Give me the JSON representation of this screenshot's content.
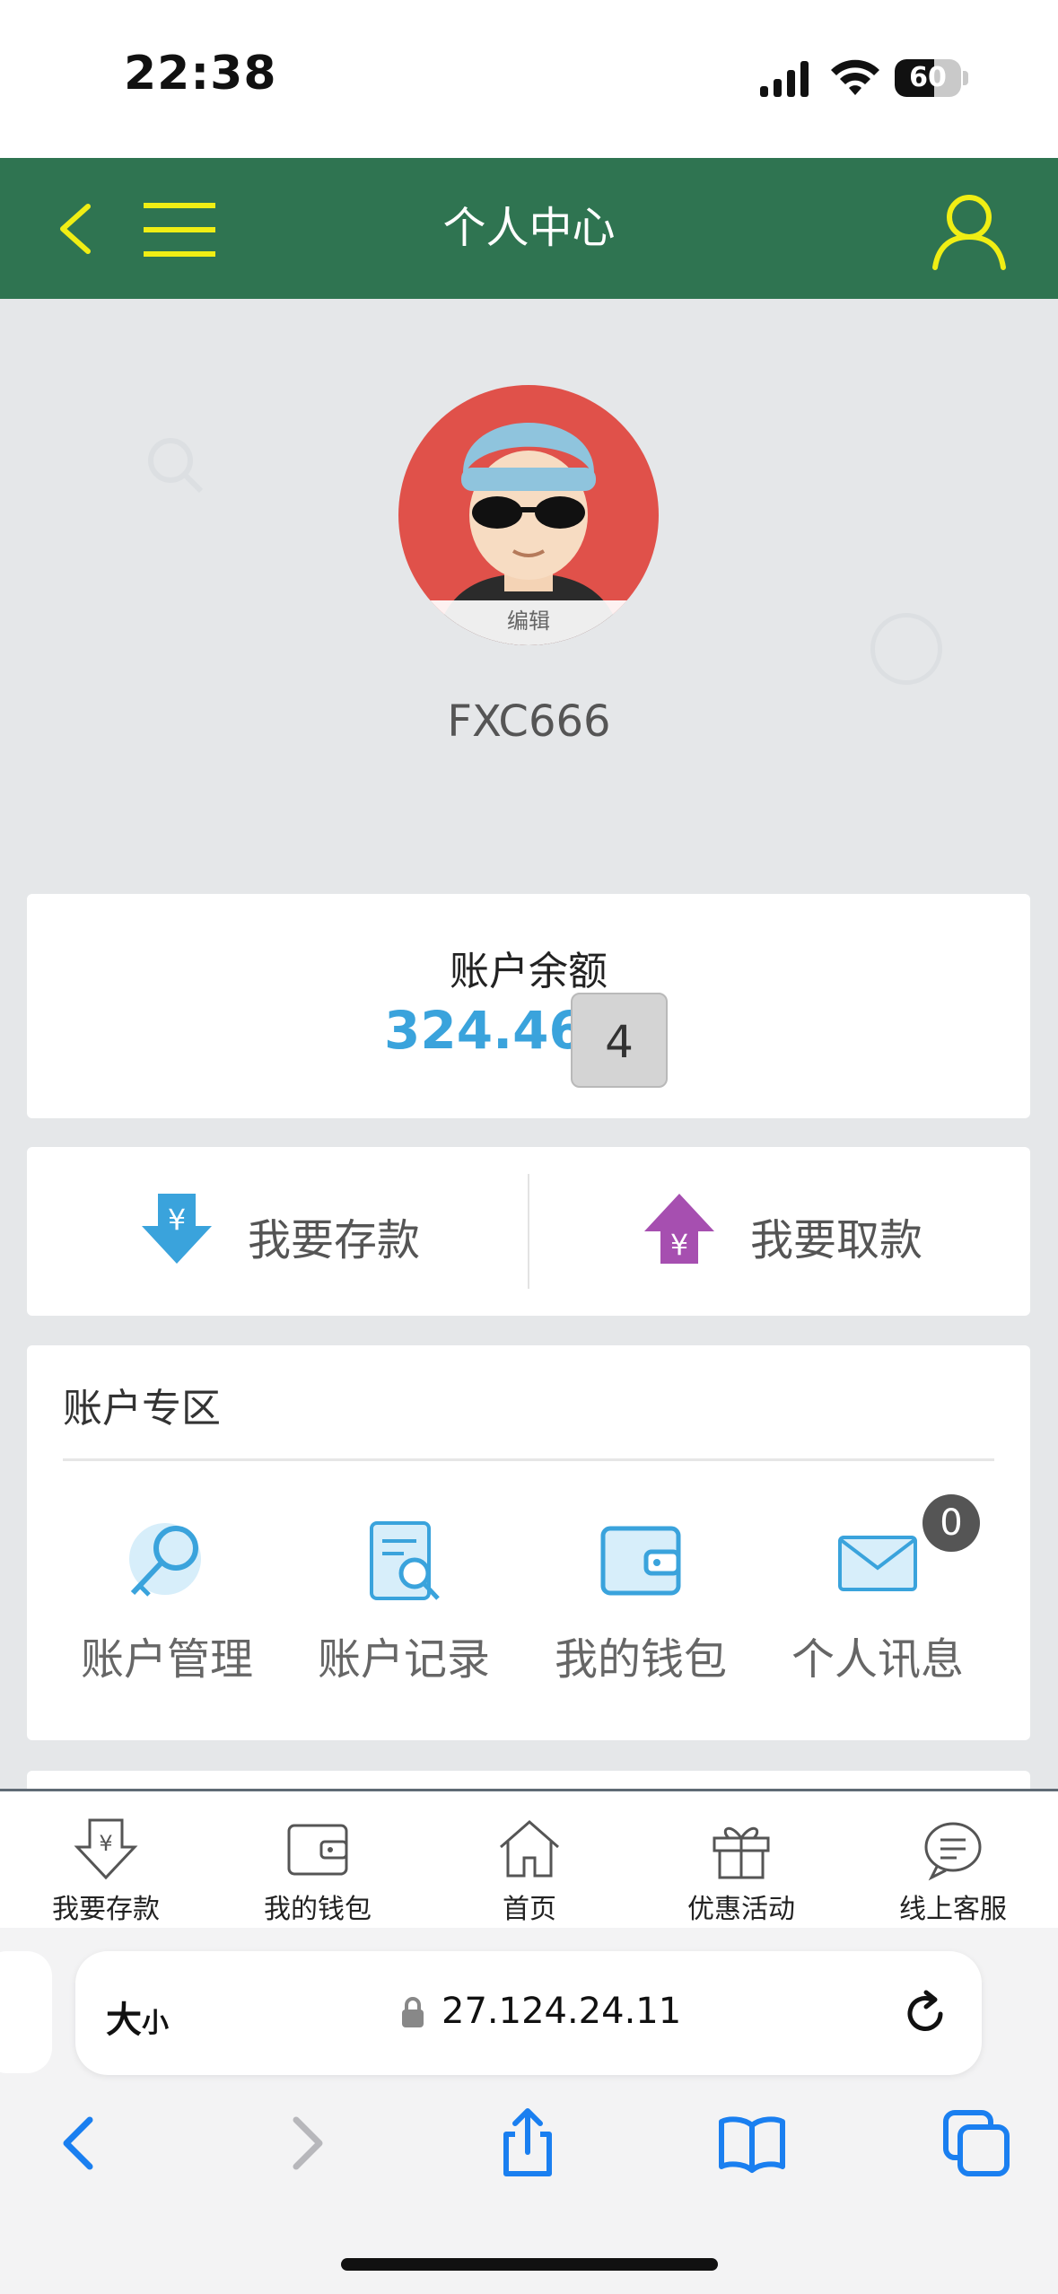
{
  "status_bar": {
    "time": "22:38",
    "battery": "60"
  },
  "nav": {
    "title": "个人中心"
  },
  "profile": {
    "avatar_edit_label": "编辑",
    "username": "FXC666"
  },
  "balance": {
    "label": "账户余额",
    "amount": "324.46",
    "count": "4"
  },
  "actions": {
    "deposit": "我要存款",
    "withdraw": "我要取款"
  },
  "account_zone": {
    "title": "账户专区",
    "items": [
      {
        "label": "账户管理",
        "icon": "key-search-icon"
      },
      {
        "label": "账户记录",
        "icon": "document-search-icon"
      },
      {
        "label": "我的钱包",
        "icon": "wallet-icon"
      },
      {
        "label": "个人讯息",
        "icon": "envelope-icon",
        "badge": "0"
      }
    ]
  },
  "tab_bar": {
    "items": [
      {
        "label": "我要存款",
        "icon": "deposit-icon"
      },
      {
        "label": "我的钱包",
        "icon": "wallet-icon"
      },
      {
        "label": "首页",
        "icon": "home-icon"
      },
      {
        "label": "优惠活动",
        "icon": "gift-icon"
      },
      {
        "label": "线上客服",
        "icon": "chat-support-icon"
      }
    ]
  },
  "browser": {
    "aa_big": "大",
    "aa_small": "小",
    "url": "27.124.24.11"
  },
  "colors": {
    "nav_bg": "#2f7451",
    "nav_icon": "#f0ee14",
    "amount": "#3aa3dc",
    "page_bg": "#e5e7e9",
    "safari_blue": "#1a7ff0"
  }
}
